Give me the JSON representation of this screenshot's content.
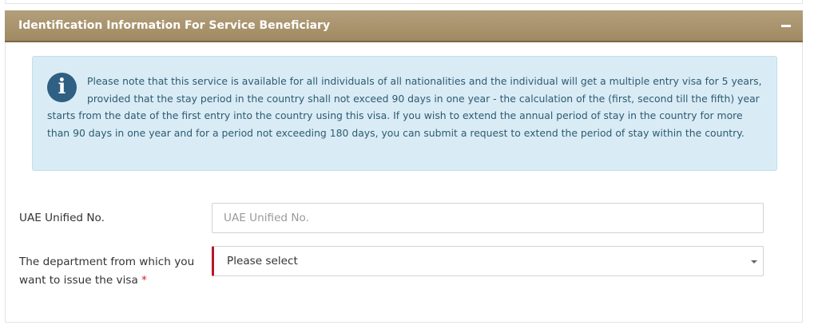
{
  "panel": {
    "title": "Identification Information For Service Beneficiary",
    "collapse_icon": "minus-icon",
    "header_color": "#a8926b"
  },
  "notice": {
    "icon": "info-icon",
    "icon_glyph": "i",
    "text": "Please note that this service is available for all individuals of all nationalities and the individual will get a multiple entry visa for 5 years, provided that the stay period in the country shall not exceed 90 days in one year - the calculation of the (first, second till the fifth) year starts from the date of the first entry into the country using this visa. If you wish to extend the annual period of stay in the country for more than 90 days in one year and for a period not exceeding 180 days, you can submit a request to extend the period of stay within the country.",
    "background_color": "#d9ecf5"
  },
  "form": {
    "uae_unified_no": {
      "label": "UAE Unified No.",
      "placeholder": "UAE Unified No.",
      "value": ""
    },
    "department": {
      "label": "The department from which you want to issue the visa",
      "required_mark": "*",
      "selected": "Please select",
      "caret_icon": "caret-down-icon",
      "required_color": "#b8162b"
    }
  }
}
